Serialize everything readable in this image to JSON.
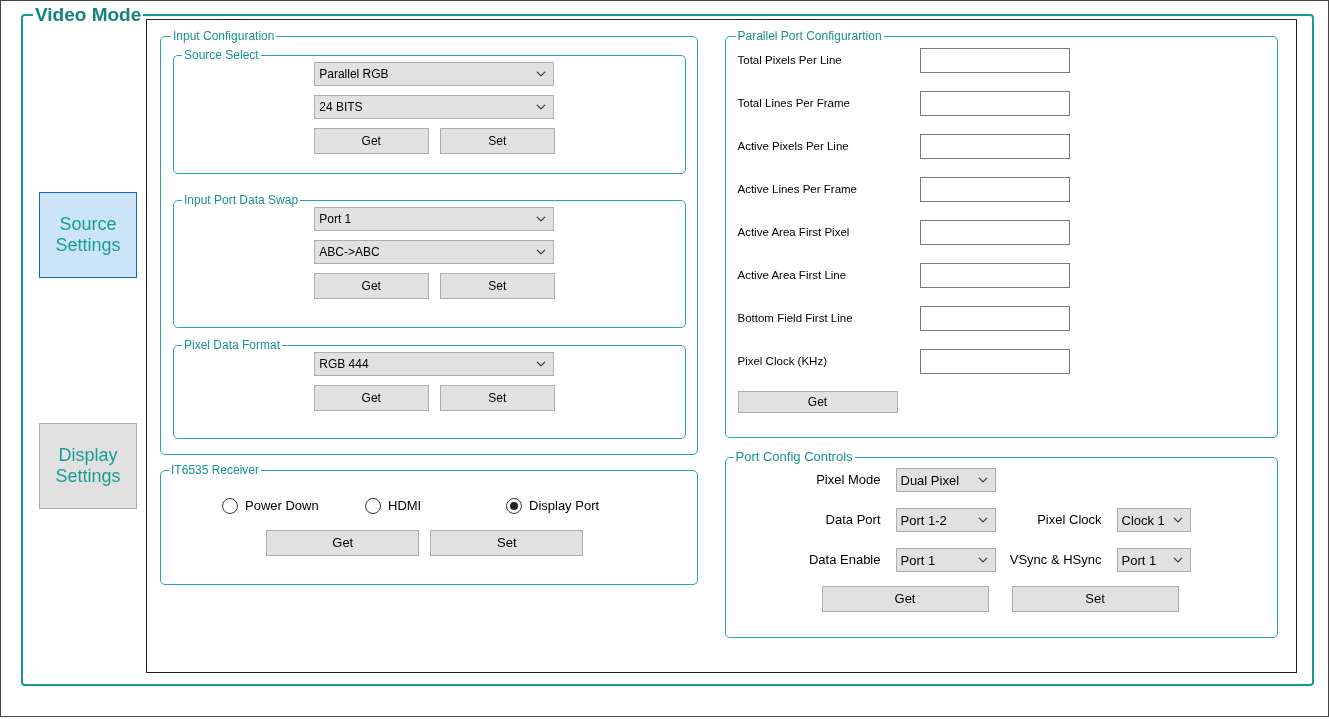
{
  "window": {
    "title": "Video Mode"
  },
  "sidebar": {
    "items": [
      {
        "label": "Source Settings",
        "selected": true
      },
      {
        "label": "Display Settings",
        "selected": false
      }
    ]
  },
  "input_configuration": {
    "title": "Input Configuration",
    "groups": [
      {
        "title": "Source Select",
        "dropdowns": [
          "Parallel RGB",
          "24 BITS"
        ],
        "buttons": [
          "Get",
          "Set"
        ]
      },
      {
        "title": "Input Port Data Swap",
        "dropdowns": [
          "Port 1",
          "ABC->ABC"
        ],
        "buttons": [
          "Get",
          "Set"
        ]
      },
      {
        "title": "Pixel Data Format",
        "dropdowns": [
          "RGB 444"
        ],
        "buttons": [
          "Get",
          "Set"
        ]
      }
    ]
  },
  "receiver": {
    "title": "IT6535 Receiver",
    "options": [
      {
        "label": "Power Down",
        "selected": false
      },
      {
        "label": "HDMI",
        "selected": false
      },
      {
        "label": "Display Port",
        "selected": true
      }
    ],
    "buttons": [
      "Get",
      "Set"
    ]
  },
  "parallel_port": {
    "title": "Parallel Port Configurartion",
    "fields": [
      {
        "label": "Total Pixels Per Line"
      },
      {
        "label": "Total Lines Per Frame"
      },
      {
        "label": "Active Pixels Per Line"
      },
      {
        "label": "Active Lines Per Frame"
      },
      {
        "label": "Active Area First Pixel"
      },
      {
        "label": "Active Area First Line"
      },
      {
        "label": "Bottom Field First Line"
      },
      {
        "label": "Pixel Clock (KHz)"
      }
    ],
    "buttons": [
      "Get"
    ]
  },
  "port_config": {
    "title": "Port Config Controls",
    "rows": [
      [
        {
          "label": "Pixel Mode",
          "value": "Dual Pixel"
        }
      ],
      [
        {
          "label": "Data Port",
          "value": "Port 1-2"
        },
        {
          "label": "Pixel Clock",
          "value": "Clock 1"
        }
      ],
      [
        {
          "label": "Data Enable",
          "value": "Port 1"
        },
        {
          "label": "VSync & HSync",
          "value": "Port 1"
        }
      ]
    ],
    "buttons": [
      "Get",
      "Set"
    ]
  }
}
